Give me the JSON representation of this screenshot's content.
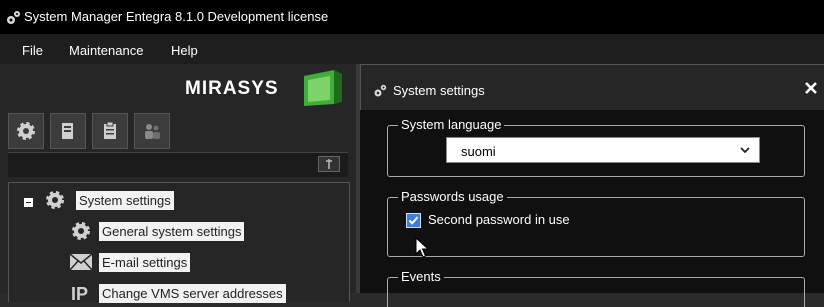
{
  "window": {
    "title": "System Manager Entegra 8.1.0 Development license"
  },
  "menu": [
    {
      "label": "File"
    },
    {
      "label": "Maintenance"
    },
    {
      "label": "Help"
    }
  ],
  "logo": {
    "text": "MIRASYS"
  },
  "tabs": [
    {
      "icon": "gear-icon"
    },
    {
      "icon": "server-icon"
    },
    {
      "icon": "clipboard-icon"
    },
    {
      "icon": "users-icon"
    }
  ],
  "tree": {
    "root": {
      "label": "System settings",
      "icon": "gear-icon",
      "expanded": true
    },
    "children": [
      {
        "label": "General system settings",
        "icon": "gear-icon"
      },
      {
        "label": "E-mail settings",
        "icon": "envelope-icon"
      },
      {
        "label": "Change VMS server addresses",
        "icon": "ip-icon"
      }
    ]
  },
  "dialog": {
    "title": "System settings",
    "language_group": {
      "legend": "System language",
      "selected": "suomi"
    },
    "passwords_group": {
      "legend": "Passwords usage",
      "checkbox_label": "Second password in use",
      "checked": true
    },
    "events_group": {
      "legend": "Events"
    }
  },
  "colors": {
    "accent_green": "#3fae3a",
    "checkbox_blue": "#3d7fd6",
    "background": "#101010"
  }
}
